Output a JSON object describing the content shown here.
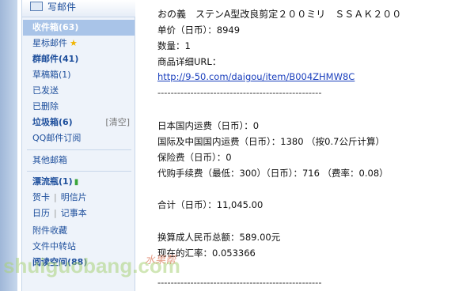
{
  "sidebar": {
    "compose_label": "写邮件",
    "items": [
      {
        "label": "收件箱(63)"
      },
      {
        "label": "星标邮件"
      },
      {
        "label": "群邮件(41)"
      },
      {
        "label": "草稿箱(1)"
      },
      {
        "label": "已发送"
      },
      {
        "label": "已删除"
      },
      {
        "label": "垃圾箱(6)",
        "action": "[清空]"
      },
      {
        "label": "QQ邮件订阅"
      },
      {
        "label": "其他邮箱"
      },
      {
        "label": "漂流瓶(1)"
      },
      {
        "label": "贺卡",
        "label2": "明信片"
      },
      {
        "label": "日历",
        "label2": "记事本"
      },
      {
        "label": "附件收藏"
      },
      {
        "label": "文件中转站"
      },
      {
        "label": "阅读空间(88)"
      }
    ]
  },
  "email": {
    "product_name": "おの義　ステンA型改良剪定２００ミリ　ＳＳＡＫ２００",
    "unit_price": "单价（日币）：8949",
    "quantity": "数量：1",
    "url_label": "商品详细URL：",
    "url": "http://9-50.com/daigou/item/B004ZHMW8C",
    "separator": "--------------------------------------------------",
    "domestic_shipping": "日本国内运费（日币）：0",
    "intl_shipping": "国际及中国国内运费（日币）：1380 （按0.7公斤计算）",
    "insurance": "保险费（日币）：0",
    "service_fee": "代购手续费（最低：300）（日币）：716 （费率：0.08）",
    "total": "合计（日币）：11,045.00",
    "rmb_total": "换算成人民币总额：589.00元",
    "exchange_rate": "现在的汇率：0.053366"
  },
  "watermark": {
    "text": "shuiguobang.com",
    "cn": "水果帮"
  }
}
